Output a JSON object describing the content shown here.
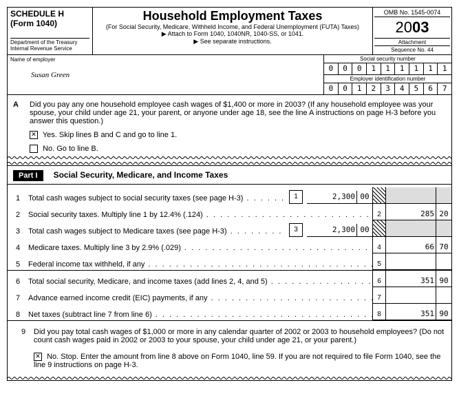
{
  "header": {
    "schedule": "SCHEDULE H",
    "form": "(Form 1040)",
    "dept": "Department of the Treasury",
    "irs": "Internal Revenue Service",
    "title": "Household Employment Taxes",
    "subtitle": "(For Social Security, Medicare, Withheld Income, and Federal Unemployment (FUTA) Taxes)",
    "attach": "▶ Attach to Form 1040, 1040NR, 1040-SS, or 1041.",
    "see": "▶ See separate instructions.",
    "omb": "OMB No. 1545-0074",
    "year_prefix": "20",
    "year_suffix": "03",
    "attach_seq_label": "Attachment",
    "seq": "Sequence No. 44"
  },
  "name": {
    "label": "Name of employer",
    "value": "Susan Green",
    "ssn_label": "Social security number",
    "ssn": [
      "0",
      "0",
      "0",
      "1",
      "1",
      "1",
      "1",
      "1",
      "1"
    ],
    "ein_label": "Employer identification number",
    "ein": [
      "0",
      "0",
      "1",
      "2",
      "3",
      "4",
      "5",
      "6",
      "7"
    ]
  },
  "questionA": {
    "letter": "A",
    "text": "Did you pay any one household employee cash wages of $1,400 or more in 2003? (If any household employee was your spouse, your child under age 21, your parent, or anyone under age 18, see the line A instructions on page H-3 before you answer this question.)",
    "yes": "Yes.  Skip lines B and C and go to line 1.",
    "no": "No.   Go to line B.",
    "yes_checked": true,
    "no_checked": false
  },
  "part1": {
    "label": "Part I",
    "title": "Social Security, Medicare, and Income Taxes"
  },
  "lines": {
    "l1": {
      "num": "1",
      "text": "Total cash wages subject to social security taxes (see page H-3)",
      "mid_num": "1",
      "mid_amount": "2,300",
      "mid_cents": "00"
    },
    "l2": {
      "num": "2",
      "text": "Social security taxes. Multiply line 1 by 12.4% (.124)",
      "end_num": "2",
      "end_amount": "285",
      "end_cents": "20"
    },
    "l3": {
      "num": "3",
      "text": "Total cash wages subject to Medicare taxes (see page H-3)",
      "mid_num": "3",
      "mid_amount": "2,300",
      "mid_cents": "00"
    },
    "l4": {
      "num": "4",
      "text": "Medicare taxes. Multiply line 3 by 2.9% (.029)",
      "end_num": "4",
      "end_amount": "66",
      "end_cents": "70"
    },
    "l5": {
      "num": "5",
      "text": "Federal income tax withheld, if any",
      "end_num": "5",
      "end_amount": "",
      "end_cents": ""
    },
    "l6": {
      "num": "6",
      "text": "Total social security, Medicare, and income taxes (add lines 2, 4, and 5)",
      "end_num": "6",
      "end_amount": "351",
      "end_cents": "90"
    },
    "l7": {
      "num": "7",
      "text": "Advance earned income credit (EIC) payments, if any",
      "end_num": "7",
      "end_amount": "",
      "end_cents": ""
    },
    "l8": {
      "num": "8",
      "text": "Net taxes (subtract line 7 from line 6)",
      "end_num": "8",
      "end_amount": "351",
      "end_cents": "90"
    }
  },
  "question9": {
    "num": "9",
    "text": "Did you pay total cash wages of $1,000 or more in any calendar quarter of 2002 or 2003 to household employees? (Do not count cash wages paid in 2002 or 2003 to your spouse, your child under age 21, or your parent.)",
    "no": "No.  Stop. Enter the amount from line 8 above on Form 1040, line 59. If you are not required to file Form 1040, see the line 9 instructions on page H-3.",
    "no_checked": true
  }
}
